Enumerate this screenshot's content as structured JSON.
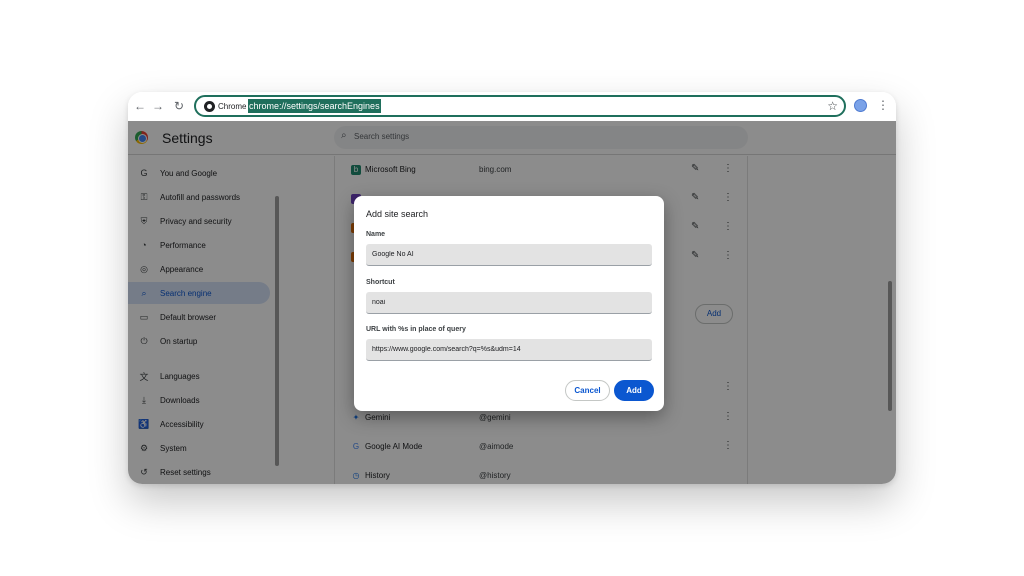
{
  "browser": {
    "chip_label": "Chrome",
    "url": "chrome://settings/searchEngines"
  },
  "header": {
    "title": "Settings",
    "search_placeholder": "Search settings"
  },
  "sidebar": {
    "items": [
      {
        "label": "You and Google",
        "icon": "G"
      },
      {
        "label": "Autofill and passwords",
        "icon": "⚿"
      },
      {
        "label": "Privacy and security",
        "icon": "⛨"
      },
      {
        "label": "Performance",
        "icon": "◔"
      },
      {
        "label": "Appearance",
        "icon": "◎"
      },
      {
        "label": "Search engine",
        "icon": "⌕"
      },
      {
        "label": "Default browser",
        "icon": "▭"
      },
      {
        "label": "On startup",
        "icon": "⏻"
      },
      {
        "label": "Languages",
        "icon": "文"
      },
      {
        "label": "Downloads",
        "icon": "⤓"
      },
      {
        "label": "Accessibility",
        "icon": "♿"
      },
      {
        "label": "System",
        "icon": "⚙"
      },
      {
        "label": "Reset settings",
        "icon": "↺"
      }
    ],
    "active_index": 5
  },
  "content": {
    "rows": [
      {
        "name": "Microsoft Bing",
        "shortcut": "bing.com",
        "icon_color": "#1f8a70",
        "icon": "b"
      },
      {
        "name": "",
        "shortcut": "",
        "icon_color": "#6f42c1",
        "icon": ""
      },
      {
        "name": "",
        "shortcut": "",
        "icon_color": "#e8710a",
        "icon": ""
      },
      {
        "name": "",
        "shortcut": "",
        "icon_color": "#e8710a",
        "icon": ""
      }
    ],
    "lower_rows": [
      {
        "name": "Gemini",
        "shortcut": "@gemini",
        "icon": "✦",
        "icon_color": "#1a73e8"
      },
      {
        "name": "Google AI Mode",
        "shortcut": "@aimode",
        "icon": "G",
        "icon_color": "#4285f4"
      },
      {
        "name": "History",
        "shortcut": "@history",
        "icon": "◷",
        "icon_color": "#1a73e8"
      }
    ],
    "add_label": "Add"
  },
  "dialog": {
    "title": "Add site search",
    "name_label": "Name",
    "name_value": "Google No AI",
    "shortcut_label": "Shortcut",
    "shortcut_value": "noai",
    "url_label": "URL with %s in place of query",
    "url_value": "https://www.google.com/search?q=%s&udm=14",
    "cancel_label": "Cancel",
    "add_label": "Add"
  }
}
